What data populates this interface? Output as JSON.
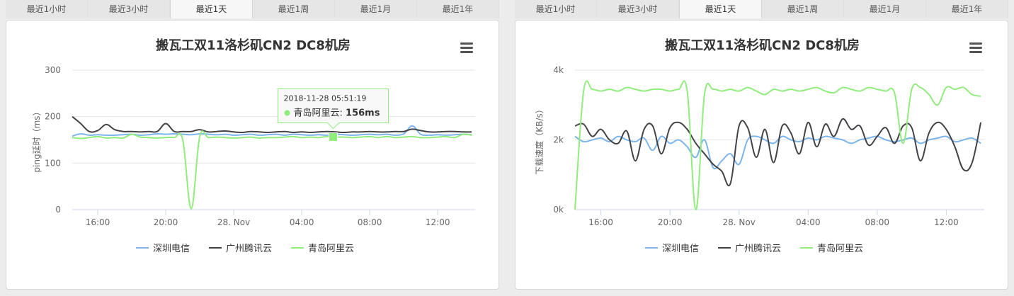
{
  "tabs": [
    "最近1小时",
    "最近3小时",
    "最近1天",
    "最近1周",
    "最近1月",
    "最近1年"
  ],
  "active_tab": 2,
  "menu_icon": "hamburger-menu-icon",
  "colors": {
    "series1": "#7cb5ec",
    "series2": "#434348",
    "series3": "#90ed7d"
  },
  "chart_data": [
    {
      "type": "line",
      "title": "搬瓦工双11洛杉矶CN2 DC8机房",
      "ylabel": "ping延时（ms）",
      "ylim": [
        0,
        300
      ],
      "yticks": [
        0,
        100,
        200,
        300
      ],
      "ytick_labels": [
        "0",
        "100",
        "200",
        "300"
      ],
      "xlim": [
        14.5,
        38.2
      ],
      "xticks": [
        16,
        20,
        24,
        28,
        32,
        36
      ],
      "xtick_labels": [
        "16:00",
        "20:00",
        "28. Nov",
        "04:00",
        "08:00",
        "12:00"
      ],
      "x": [
        14.5,
        15,
        15.5,
        16,
        16.5,
        17,
        17.5,
        18,
        18.5,
        19,
        19.5,
        20,
        20.5,
        21,
        21.5,
        22,
        22.5,
        23,
        23.5,
        24,
        24.5,
        25,
        25.5,
        26,
        26.5,
        27,
        27.5,
        28,
        28.5,
        29,
        29.5,
        30,
        30.5,
        31,
        31.5,
        32,
        32.5,
        33,
        33.5,
        34,
        34.5,
        35,
        35.5,
        36,
        36.5,
        37,
        37.5,
        38
      ],
      "series": [
        {
          "name": "深圳电信",
          "values": [
            158,
            163,
            160,
            161,
            160,
            160,
            161,
            162,
            160,
            161,
            163,
            162,
            163,
            162,
            161,
            163,
            162,
            161,
            162,
            160,
            161,
            162,
            160,
            161,
            162,
            160,
            162,
            161,
            160,
            161,
            160,
            162,
            161,
            160,
            161,
            162,
            161,
            162,
            160,
            163,
            180,
            162,
            160,
            161,
            160,
            161,
            162,
            161
          ]
        },
        {
          "name": "广州腾讯云",
          "values": [
            200,
            185,
            168,
            170,
            183,
            172,
            168,
            168,
            167,
            168,
            168,
            185,
            168,
            168,
            168,
            172,
            167,
            168,
            169,
            167,
            166,
            168,
            167,
            166,
            167,
            168,
            166,
            167,
            166,
            167,
            168,
            167,
            166,
            167,
            167,
            168,
            167,
            167,
            168,
            168,
            173,
            170,
            167,
            167,
            168,
            168,
            167,
            167
          ]
        },
        {
          "name": "青岛阿里云",
          "values": [
            155,
            153,
            155,
            157,
            154,
            155,
            154,
            162,
            156,
            155,
            154,
            155,
            155,
            150,
            2,
            157,
            155,
            156,
            155,
            154,
            155,
            156,
            154,
            155,
            155,
            156,
            157,
            155,
            156,
            155,
            157,
            156,
            156,
            155,
            156,
            157,
            155,
            157,
            155,
            156,
            157,
            155,
            155,
            156,
            157,
            155,
            162,
            160
          ]
        }
      ],
      "tooltip": {
        "date": "2018-11-28 05:51:19",
        "series": "青岛阿里云",
        "value": "156ms",
        "x": 29.85,
        "y": 156
      }
    },
    {
      "type": "line",
      "title": "搬瓦工双11洛杉矶CN2 DC8机房",
      "ylabel": "下载速度（KB/s）",
      "ylim": [
        0,
        4000
      ],
      "yticks": [
        0,
        2000,
        4000
      ],
      "ytick_labels": [
        "0k",
        "2k",
        "4k"
      ],
      "xlim": [
        14.5,
        38.2
      ],
      "xticks": [
        16,
        20,
        24,
        28,
        32,
        36
      ],
      "xtick_labels": [
        "16:00",
        "20:00",
        "28. Nov",
        "04:00",
        "08:00",
        "12:00"
      ],
      "x": [
        14.5,
        15,
        15.5,
        16,
        16.5,
        17,
        17.5,
        18,
        18.5,
        19,
        19.5,
        20,
        20.5,
        21,
        21.5,
        22,
        22.5,
        23,
        23.5,
        24,
        24.5,
        25,
        25.5,
        26,
        26.5,
        27,
        27.5,
        28,
        28.5,
        29,
        29.5,
        30,
        30.5,
        31,
        31.5,
        32,
        32.5,
        33,
        33.5,
        34,
        34.5,
        35,
        35.5,
        36,
        36.5,
        37,
        37.5,
        38
      ],
      "series": [
        {
          "name": "深圳电信",
          "values": [
            2100,
            1950,
            2000,
            2050,
            1950,
            2100,
            2000,
            1950,
            2050,
            1700,
            2100,
            1900,
            2000,
            1800,
            1500,
            2000,
            1200,
            1400,
            1600,
            1300,
            2000,
            2100,
            2000,
            1900,
            2100,
            2000,
            1950,
            2050,
            2000,
            2100,
            2050,
            2000,
            1900,
            2000,
            2050,
            2100,
            2000,
            1950,
            2000,
            2050,
            1900,
            2000,
            2050,
            2100,
            1950,
            2000,
            2050,
            1900
          ]
        },
        {
          "name": "广州腾讯云",
          "values": [
            2400,
            2450,
            2100,
            2300,
            2000,
            1900,
            2250,
            1400,
            2300,
            2400,
            1600,
            2350,
            2500,
            2300,
            1900,
            1600,
            1300,
            1100,
            750,
            2400,
            2350,
            1500,
            2300,
            1350,
            2400,
            2200,
            1600,
            2500,
            1800,
            2450,
            2100,
            2600,
            2300,
            2400,
            1850,
            2100,
            2350,
            1900,
            2400,
            2350,
            1400,
            2200,
            2500,
            2300,
            1800,
            1150,
            1350,
            2500
          ]
        },
        {
          "name": "青岛阿里云",
          "values": [
            0,
            3400,
            3450,
            3400,
            3450,
            3400,
            3500,
            3450,
            3400,
            3450,
            3450,
            3400,
            3450,
            3400,
            0,
            3300,
            3450,
            3400,
            3450,
            3400,
            3500,
            3400,
            3300,
            3450,
            3400,
            3450,
            3400,
            3450,
            3500,
            3400,
            3350,
            3500,
            3450,
            3400,
            3500,
            3450,
            3400,
            3350,
            1900,
            3450,
            3500,
            3300,
            3000,
            3500,
            3450,
            3500,
            3300,
            3250
          ]
        }
      ]
    }
  ]
}
